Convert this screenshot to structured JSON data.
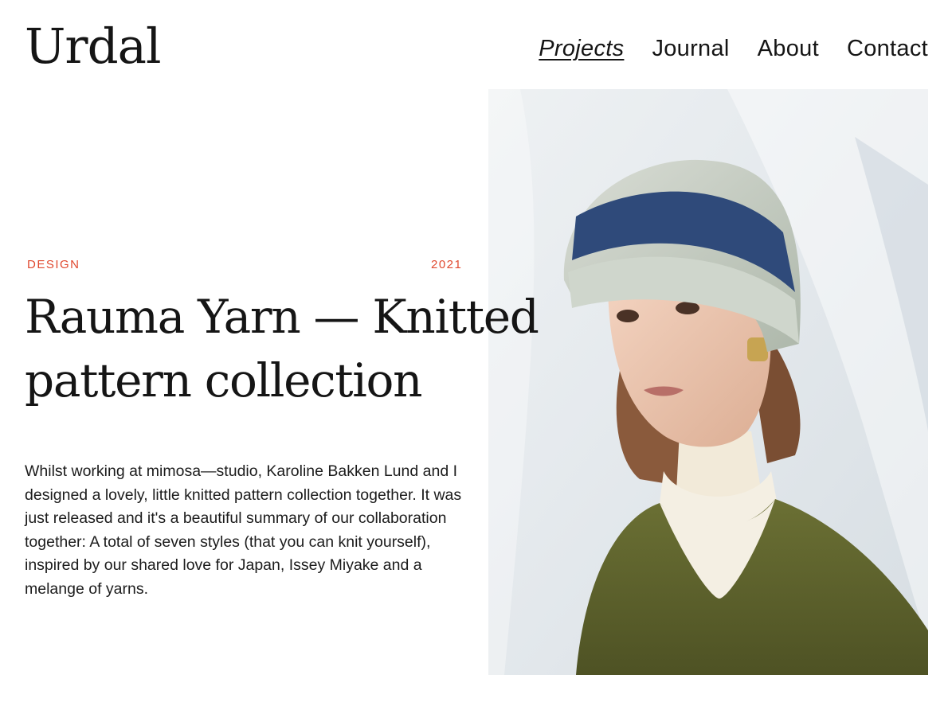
{
  "header": {
    "logo": "Urdal",
    "nav": [
      {
        "label": "Projects",
        "active": true
      },
      {
        "label": "Journal",
        "active": false
      },
      {
        "label": "About",
        "active": false
      },
      {
        "label": "Contact",
        "active": false
      }
    ]
  },
  "project": {
    "category": "DESIGN",
    "year": "2021",
    "title": "Rauma Yarn — Knitted pattern collection",
    "description": "Whilst working at mimosa—studio, Karoline Bakken Lund and I designed a lovely, little knitted pattern collection together. It was just released and it's a beautiful summary of our collaboration together: A total of seven styles (that you can knit yourself), inspired by our shared love for Japan, Issey Miyake and a melange of yarns."
  },
  "colors": {
    "accent": "#e0492f",
    "text": "#151515",
    "background": "#ffffff"
  }
}
